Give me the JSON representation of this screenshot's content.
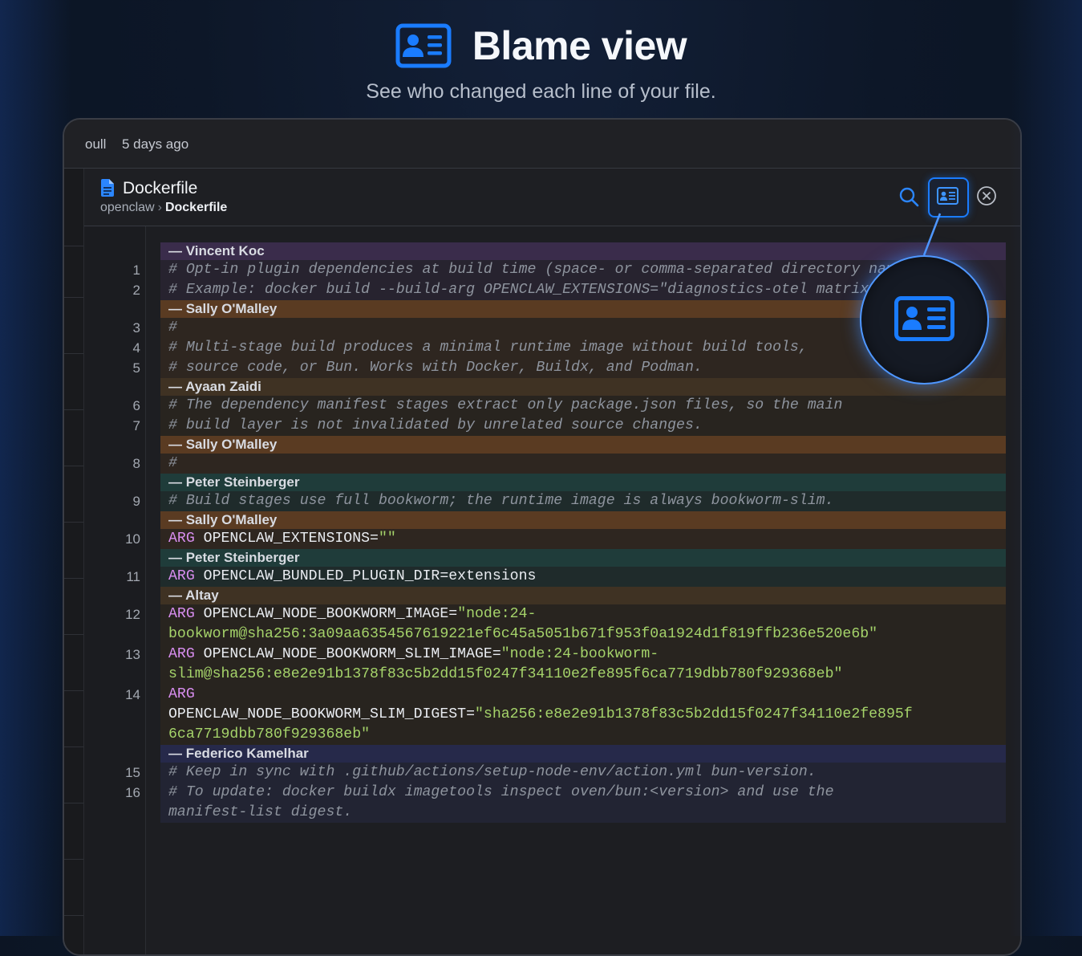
{
  "hero": {
    "title": "Blame view",
    "subtitle": "See who changed each line of your file.",
    "icon": "id-card-icon"
  },
  "commit_bar": {
    "author": "oull",
    "time": "5 days ago"
  },
  "file": {
    "name": "Dockerfile",
    "breadcrumb_root": "openclaw",
    "breadcrumb_separator": "›",
    "breadcrumb_current": "Dockerfile",
    "icon": "document-icon"
  },
  "toolbar": {
    "search_icon": "search-icon",
    "blame_icon": "id-card-icon",
    "close_icon": "close-circle-icon"
  },
  "colors": {
    "accent": "#1a7cff",
    "keyword": "#d98ef0",
    "string": "#a5d36a",
    "comment": "#8e949e"
  },
  "hunks": [
    {
      "author": "— Vincent Koc",
      "color": "purple",
      "lines": [
        {
          "num": "1",
          "parts": [
            {
              "cls": "cmt",
              "text": "# Opt-in plugin dependencies at build time (space- or comma-separated directory names)."
            }
          ]
        },
        {
          "num": "2",
          "parts": [
            {
              "cls": "cmt",
              "text": "# Example: docker build --build-arg OPENCLAW_EXTENSIONS=\"diagnostics-otel matrix\" ."
            }
          ]
        }
      ]
    },
    {
      "author": "— Sally O'Malley",
      "color": "orange",
      "lines": [
        {
          "num": "3",
          "parts": [
            {
              "cls": "cmt",
              "text": "#"
            }
          ]
        },
        {
          "num": "4",
          "parts": [
            {
              "cls": "cmt",
              "text": "# Multi-stage build produces a minimal runtime image without build tools,"
            }
          ]
        },
        {
          "num": "5",
          "parts": [
            {
              "cls": "cmt",
              "text": "# source code, or Bun. Works with Docker, Buildx, and Podman."
            }
          ]
        }
      ]
    },
    {
      "author": "— Ayaan Zaidi",
      "color": "brown",
      "lines": [
        {
          "num": "6",
          "parts": [
            {
              "cls": "cmt",
              "text": "# The dependency manifest stages extract only package.json files, so the main"
            }
          ]
        },
        {
          "num": "7",
          "parts": [
            {
              "cls": "cmt",
              "text": "# build layer is not invalidated by unrelated source changes."
            }
          ]
        }
      ]
    },
    {
      "author": "— Sally O'Malley",
      "color": "orange",
      "lines": [
        {
          "num": "8",
          "parts": [
            {
              "cls": "cmt",
              "text": "#"
            }
          ]
        }
      ]
    },
    {
      "author": "— Peter Steinberger",
      "color": "teal",
      "lines": [
        {
          "num": "9",
          "parts": [
            {
              "cls": "cmt",
              "text": "# Build stages use full bookworm; the runtime image is always bookworm-slim."
            }
          ]
        }
      ]
    },
    {
      "author": "— Sally O'Malley",
      "color": "orange",
      "lines": [
        {
          "num": "10",
          "parts": [
            {
              "cls": "kw",
              "text": "ARG"
            },
            {
              "cls": "plain",
              "text": " OPENCLAW_EXTENSIONS="
            },
            {
              "cls": "str",
              "text": "\"\""
            }
          ]
        }
      ]
    },
    {
      "author": "— Peter Steinberger",
      "color": "teal",
      "lines": [
        {
          "num": "11",
          "parts": [
            {
              "cls": "kw",
              "text": "ARG"
            },
            {
              "cls": "plain",
              "text": " OPENCLAW_BUNDLED_PLUGIN_DIR=extensions"
            }
          ]
        }
      ]
    },
    {
      "author": "— Altay",
      "color": "brown",
      "lines": [
        {
          "num": "12",
          "parts": [
            {
              "cls": "kw",
              "text": "ARG"
            },
            {
              "cls": "plain",
              "text": " OPENCLAW_NODE_BOOKWORM_IMAGE="
            },
            {
              "cls": "str",
              "text": "\"node:24-\nbookworm@sha256:3a09aa6354567619221ef6c45a5051b671f953f0a1924d1f819ffb236e520e6b\""
            }
          ]
        },
        {
          "num": "13",
          "parts": [
            {
              "cls": "kw",
              "text": "ARG"
            },
            {
              "cls": "plain",
              "text": " OPENCLAW_NODE_BOOKWORM_SLIM_IMAGE="
            },
            {
              "cls": "str",
              "text": "\"node:24-bookworm-\nslim@sha256:e8e2e91b1378f83c5b2dd15f0247f34110e2fe895f6ca7719dbb780f929368eb\""
            }
          ]
        },
        {
          "num": "14",
          "parts": [
            {
              "cls": "kw",
              "text": "ARG"
            },
            {
              "cls": "plain",
              "text": "\nOPENCLAW_NODE_BOOKWORM_SLIM_DIGEST="
            },
            {
              "cls": "str",
              "text": "\"sha256:e8e2e91b1378f83c5b2dd15f0247f34110e2fe895f\n6ca7719dbb780f929368eb\""
            }
          ]
        }
      ]
    },
    {
      "author": "— Federico Kamelhar",
      "color": "navy",
      "lines": [
        {
          "num": "15",
          "parts": [
            {
              "cls": "cmt",
              "text": "# Keep in sync with .github/actions/setup-node-env/action.yml bun-version."
            }
          ]
        },
        {
          "num": "16",
          "parts": [
            {
              "cls": "cmt",
              "text": "# To update: docker buildx imagetools inspect oven/bun:<version> and use the\nmanifest-list digest."
            }
          ]
        }
      ]
    }
  ]
}
